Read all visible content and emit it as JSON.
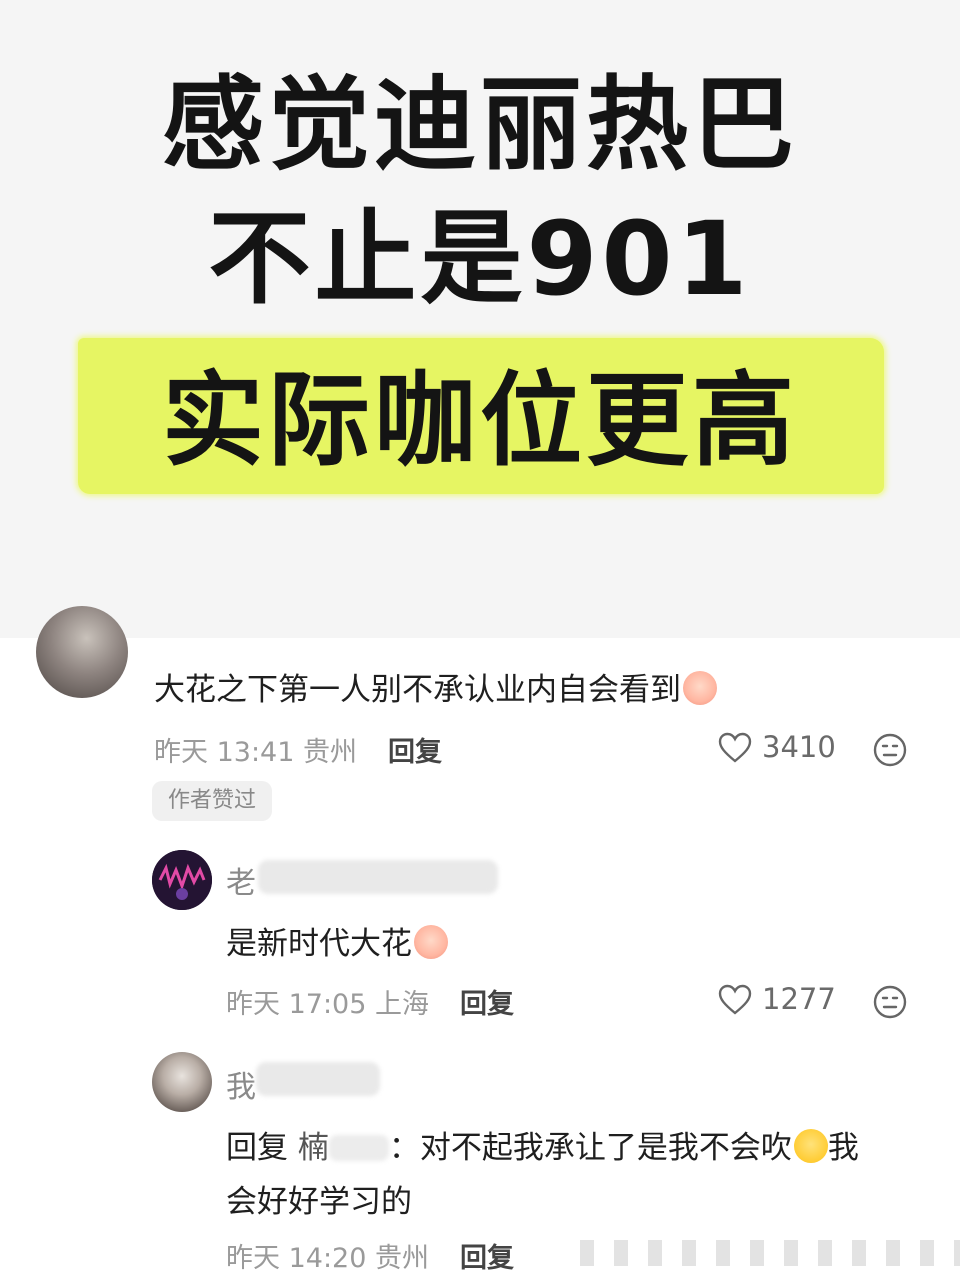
{
  "header": {
    "line1": "感觉迪丽热巴",
    "line2": "不止是901",
    "line3": "实际咖位更高",
    "highlight_color": "#e6f563"
  },
  "comments": [
    {
      "text": "大花之下第一人别不承认业内自会看到",
      "time": "昨天 13:41",
      "location": "贵州",
      "reply_label": "回复",
      "likes": "3410",
      "badge": "作者赞过"
    },
    {
      "name": "老",
      "text": "是新时代大花",
      "time": "昨天 17:05",
      "location": "上海",
      "reply_label": "回复",
      "likes": "1277"
    },
    {
      "name": "我",
      "reply_prefix": "回复",
      "reply_to": "楠",
      "text_line1": "：对不起我承让了是我不会吹",
      "text_line1_tail": "我",
      "text_line2": "会好好学习的",
      "time": "昨天 14:20",
      "location": "贵州",
      "reply_label": "回复"
    }
  ],
  "icons": {
    "like": "heart-outline-icon",
    "dislike": "neutral-face-icon"
  }
}
